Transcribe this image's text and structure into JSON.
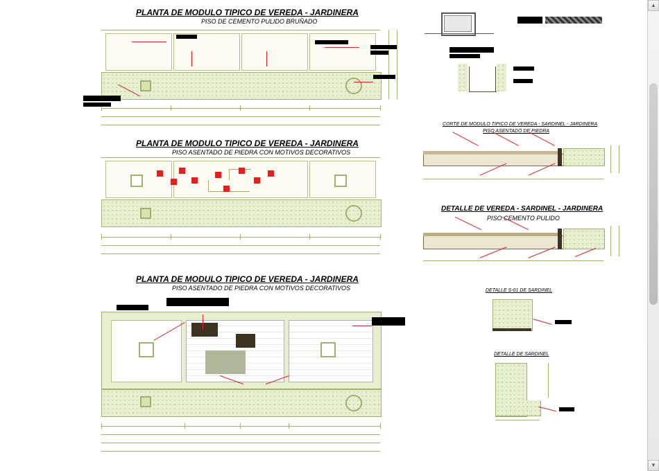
{
  "plans": [
    {
      "title": "PLANTA DE MODULO TIPICO DE VEREDA - JARDINERA",
      "subtitle": "PISO DE CEMENTO PULIDO BRUÑADO"
    },
    {
      "title": "PLANTA DE MODULO TIPICO DE VEREDA - JARDINERA",
      "subtitle": "PISO ASENTADO DE PIEDRA CON MOTIVOS DECORATIVOS"
    },
    {
      "title": "PLANTA DE MODULO TIPICO DE VEREDA - JARDINERA",
      "subtitle": "PISO ASENTADO DE PIEDRA CON MOTIVOS DECORATIVOS"
    }
  ],
  "details": {
    "section1": {
      "title": "CORTE DE MODULO TIPICO DE VEREDA - SARDINEL - JARDINERA",
      "subtitle": "PISO ASENTADO DE PIEDRA"
    },
    "section2": {
      "title": "DETALLE DE VEREDA - SARDINEL - JARDINERA",
      "subtitle": "PISO CEMENTO PULIDO"
    },
    "sardet1": "DETALLE S-01 DE SARDINEL",
    "sardet2": "DETALLE DE SARDINEL"
  }
}
